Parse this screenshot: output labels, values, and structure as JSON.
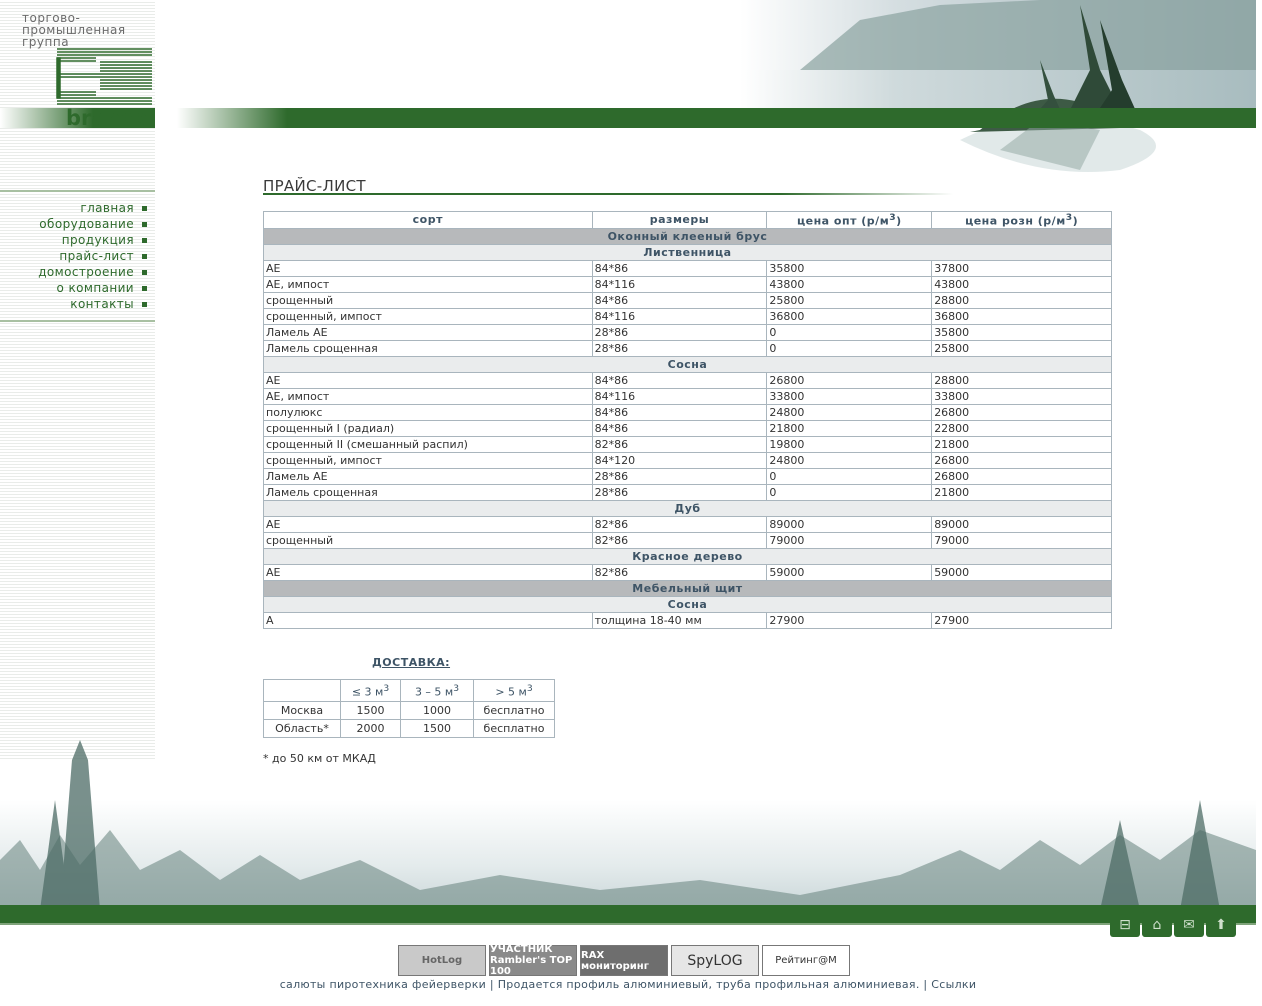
{
  "logo": {
    "line1": "торгово-",
    "line2": "промышленная",
    "line3": "группа",
    "brand": "branco"
  },
  "nav": {
    "items": [
      {
        "label": "главная"
      },
      {
        "label": "оборудование"
      },
      {
        "label": "продукция"
      },
      {
        "label": "прайс-лист"
      },
      {
        "label": "домостроение"
      },
      {
        "label": "о компании"
      },
      {
        "label": "контакты"
      }
    ]
  },
  "page": {
    "title": "ПРАЙС-ЛИСТ"
  },
  "price_table": {
    "headers": {
      "sort": "сорт",
      "size": "размеры",
      "opt": "цена опт (р/м",
      "rozn": "цена розн (р/м",
      "sup": "3",
      "close": ")"
    },
    "rows": [
      {
        "kind": "group",
        "label": "Оконный клееный брус"
      },
      {
        "kind": "sub",
        "label": "Лиственница"
      },
      {
        "kind": "row",
        "cells": [
          "АЕ",
          "84*86",
          "35800",
          "37800"
        ]
      },
      {
        "kind": "row",
        "cells": [
          "АЕ, импост",
          "84*116",
          "43800",
          "43800"
        ]
      },
      {
        "kind": "row",
        "cells": [
          "срощенный",
          "84*86",
          "25800",
          "28800"
        ]
      },
      {
        "kind": "row",
        "cells": [
          "срощенный, импост",
          "84*116",
          "36800",
          "36800"
        ]
      },
      {
        "kind": "row",
        "cells": [
          "Ламель АЕ",
          "28*86",
          "0",
          "35800"
        ]
      },
      {
        "kind": "row",
        "cells": [
          "Ламель срощенная",
          "28*86",
          "0",
          "25800"
        ]
      },
      {
        "kind": "sub",
        "label": "Сосна"
      },
      {
        "kind": "row",
        "cells": [
          "АЕ",
          "84*86",
          "26800",
          "28800"
        ]
      },
      {
        "kind": "row",
        "cells": [
          "АЕ, импост",
          "84*116",
          "33800",
          "33800"
        ]
      },
      {
        "kind": "row",
        "cells": [
          "полулюкс",
          "84*86",
          "24800",
          "26800"
        ]
      },
      {
        "kind": "row",
        "cells": [
          "срощенный I (радиал)",
          "84*86",
          "21800",
          "22800"
        ]
      },
      {
        "kind": "row",
        "cells": [
          "срощенный II (смешанный распил)",
          "82*86",
          "19800",
          "21800"
        ]
      },
      {
        "kind": "row",
        "cells": [
          "срощенный, импост",
          "84*120",
          "24800",
          "26800"
        ]
      },
      {
        "kind": "row",
        "cells": [
          "Ламель АЕ",
          "28*86",
          "0",
          "26800"
        ]
      },
      {
        "kind": "row",
        "cells": [
          "Ламель срощенная",
          "28*86",
          "0",
          "21800"
        ]
      },
      {
        "kind": "sub",
        "label": "Дуб"
      },
      {
        "kind": "row",
        "cells": [
          "АЕ",
          "82*86",
          "89000",
          "89000"
        ]
      },
      {
        "kind": "row",
        "cells": [
          "срощенный",
          "82*86",
          "79000",
          "79000"
        ]
      },
      {
        "kind": "sub",
        "label": "Красное дерево"
      },
      {
        "kind": "row",
        "cells": [
          "АЕ",
          "82*86",
          "59000",
          "59000"
        ]
      },
      {
        "kind": "group",
        "label": "Мебельный щит"
      },
      {
        "kind": "sub",
        "label": "Сосна"
      },
      {
        "kind": "row",
        "cells": [
          "А",
          "толщина 18-40 мм",
          "27900",
          "27900"
        ]
      }
    ]
  },
  "delivery": {
    "title": "ДОСТАВКА:",
    "headers": [
      "",
      "≤ 3 м",
      "3 – 5 м",
      "> 5 м"
    ],
    "sup": "3",
    "rows": [
      [
        "Москва",
        "1500",
        "1000",
        "бесплатно"
      ],
      [
        "Область*",
        "2000",
        "1500",
        "бесплатно"
      ]
    ],
    "note": "* до 50 км от МКАД"
  },
  "footer": {
    "icons": [
      "sitemap-icon",
      "home-icon",
      "mail-icon",
      "up-arrow-icon"
    ],
    "counters": [
      {
        "label": "HotLog"
      },
      {
        "label": "УЧАСТНИК Rambler's TOP 100"
      },
      {
        "label": "RAX мониторинг"
      },
      {
        "label": "SpyLOG"
      },
      {
        "label": "Рейтинг@M"
      }
    ],
    "link1": "салюты пиротехника фейерверки",
    "sep1": " | ",
    "link2": "Продается профиль алюминиевый, труба профильная алюминиевая.",
    "sep2": " | ",
    "link3": "Ссылки"
  },
  "colors": {
    "brand_green": "#2e6a2c",
    "header_text": "#3e5466",
    "group_bg": "#b7b9bb",
    "sub_bg": "#eaeced"
  }
}
